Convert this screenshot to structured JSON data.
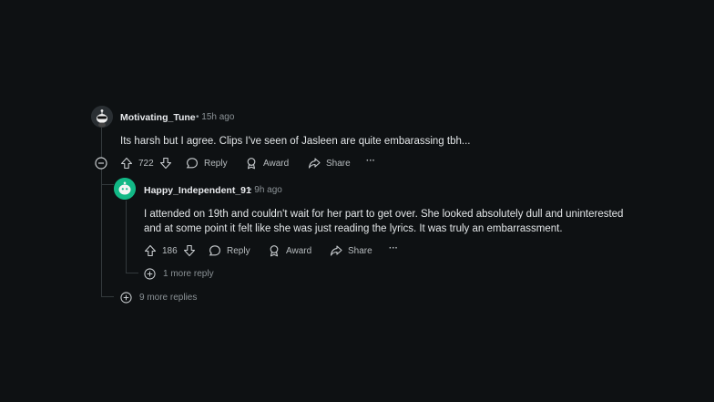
{
  "comment1": {
    "username": "Motivating_Tune",
    "time": "• 15h ago",
    "body": "Its harsh but I agree. Clips I've seen of Jasleen are quite embarassing tbh...",
    "votes": "722",
    "reply_label": "Reply",
    "award_label": "Award",
    "share_label": "Share",
    "more_label": "···"
  },
  "comment2": {
    "username": "Happy_Independent_91",
    "time": "• 9h ago",
    "body_line1": "I attended on 19th and couldn't wait for her part to get over. She looked absolutely dull and uninterested",
    "body_line2": "and at some point it felt like she was just reading the lyrics. It was truly an embarrassment.",
    "votes": "186",
    "reply_label": "Reply",
    "award_label": "Award",
    "share_label": "Share",
    "more_label": "···"
  },
  "more_reply_nested": "1 more reply",
  "more_replies_top": "9 more replies",
  "colors": {
    "background": "#0e1113",
    "thread_line": "#33393c",
    "avatar2": "#12b886"
  }
}
